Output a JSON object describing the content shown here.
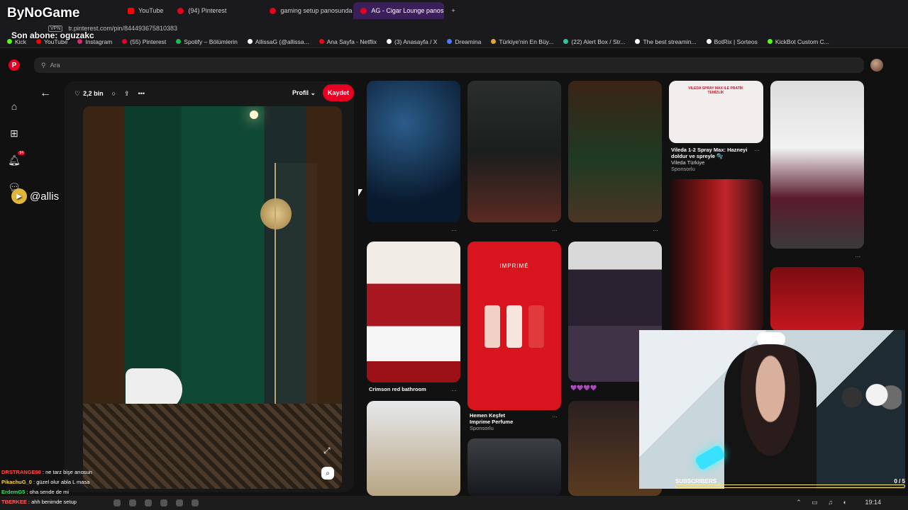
{
  "stream_overlay": {
    "brand": "ByNoGame",
    "last_subscriber": "Son abone: oguzakc",
    "social_handle": "@allis"
  },
  "browser": {
    "tabs": [
      {
        "label": "YouTube",
        "favicon": "youtube-icon",
        "active": false
      },
      {
        "label": "(94) Pinterest",
        "favicon": "pinterest-icon",
        "active": false
      },
      {
        "label": "gaming setup panosunda",
        "favicon": "pinterest-icon",
        "active": false
      },
      {
        "label": "AG - Cigar Lounge panos",
        "favicon": "pinterest-icon",
        "active": true
      }
    ],
    "vpn_label": "VPN",
    "url": "tr.pinterest.com/pin/844493675810383",
    "bookmarks": [
      {
        "label": "Kick",
        "color": "#53fc18"
      },
      {
        "label": "YouTube",
        "color": "#ff0000"
      },
      {
        "label": "Instagram",
        "color": "#d62976"
      },
      {
        "label": "(55) Pinterest",
        "color": "#e60023"
      },
      {
        "label": "Spotify – Bölümlerin",
        "color": "#1db954"
      },
      {
        "label": "AllissaG (@allissa...",
        "color": "#ffffff"
      },
      {
        "label": "Ana Sayfa - Netflix",
        "color": "#e50914"
      },
      {
        "label": "(3) Anasayfa / X",
        "color": "#ffffff"
      },
      {
        "label": "Dreamina",
        "color": "#4b7bff"
      },
      {
        "label": "Türkiye'nin En Büy...",
        "color": "#e0a63a"
      },
      {
        "label": "(22) Alert Box / Str...",
        "color": "#31c3a2"
      },
      {
        "label": "The best streamin...",
        "color": "#ffffff"
      },
      {
        "label": "BotRix | Sorteos",
        "color": "#ffffff"
      },
      {
        "label": "KickBot Custom C...",
        "color": "#53fc18"
      }
    ]
  },
  "pinterest": {
    "search_placeholder": "Ara",
    "rail_badge": "94",
    "pin": {
      "likes": "2,2 bin",
      "board_select": "Profil",
      "save_label": "Kaydet"
    },
    "grid_captions": {
      "vileda_title": "Vileda 1-2 Spray Max: Hazneyi doldur ve spreyle 🫧",
      "vileda_sponsor": "Vileda Türkiye",
      "sponsored": "Sponsorlu",
      "crimson": "Crimson red bathroom",
      "imprime_title": "Hemen Keşfet",
      "imprime_sub": "Imprime Perfume",
      "imprime_sponsor": "Sponsorlu",
      "imprime_logo": "IMPRIMÉ",
      "hearts": "💜💜💜💜",
      "vileda_ad_text": "VILEDA SPRAY MAX ILE PRATİK TEMİZLİK"
    }
  },
  "stream": {
    "subscribers_label": "SUBSCRIBERS",
    "subscribers_progress": "0 / 5",
    "chat": [
      {
        "user": "DRSTRANGE98",
        "text": "ne tarz bişe arıosun",
        "color": "#ff4d4d"
      },
      {
        "user": "PikachuG_0",
        "text": "güzel olur abla L masa",
        "color": "#ffd33a"
      },
      {
        "user": "ErdemG5",
        "text": "oha sende de mi",
        "color": "#3ae06b"
      },
      {
        "user": "TBERKEE",
        "text": "ahh benimde setup",
        "color": "#ff5b5b"
      }
    ]
  },
  "taskbar": {
    "clock": "19:14"
  }
}
